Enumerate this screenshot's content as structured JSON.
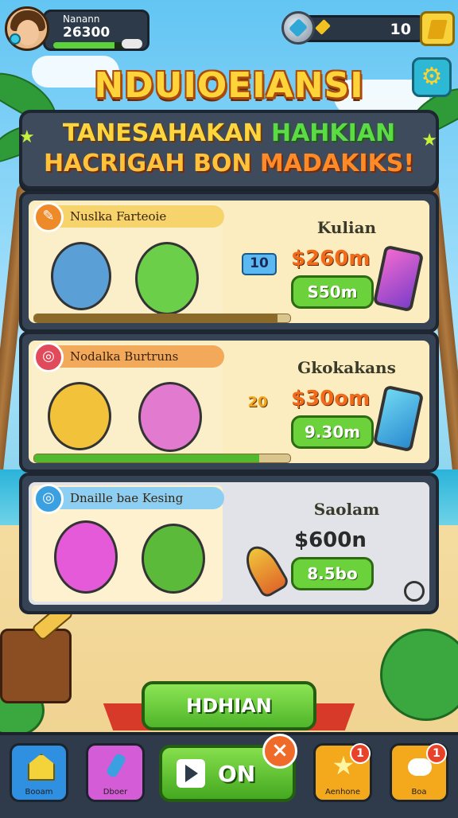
{
  "player": {
    "name": "Nanann",
    "score": "26300",
    "xp_progress": 0.85
  },
  "currency": {
    "gems_value": "10"
  },
  "title": "NDUIOEIANSI",
  "banner": {
    "line1_a": "TANESAHAKAN",
    "line1_b": "HAHKIAN",
    "line2_a": "HACRIGAH BON",
    "line2_b": "MADAKIKS!"
  },
  "offers": [
    {
      "tag": "Nuslka Farteoie",
      "right_title": "Kulian",
      "badge_value": "10",
      "price": "$260m",
      "buy_label": "S50m",
      "tag_color": "#f29a2e",
      "progress": 0.95
    },
    {
      "tag": "Nodalka Burtruns",
      "right_title": "Gkokakans",
      "badge_value": "20",
      "price": "$30om",
      "buy_label": "9.30m",
      "tag_color": "#ef7a32",
      "progress": 0.88
    },
    {
      "tag": "Dnaille bae Kesing",
      "right_title": "Saolam",
      "badge_value": "",
      "price": "$600n",
      "buy_label": "8.5bo",
      "tag_color": "#56b9ea",
      "progress": 0
    }
  ],
  "main_button": "HDHIAN",
  "nav": [
    {
      "label": "Booam",
      "color": "#2f8fe0",
      "notification": ""
    },
    {
      "label": "Dboer",
      "color": "#d45cd6",
      "notification": ""
    },
    {
      "label": "ON",
      "color": "#4fb52a",
      "notification": "×"
    },
    {
      "label": "Aenhone",
      "color": "#f4a81c",
      "notification": "1"
    },
    {
      "label": "Boa",
      "color": "#f4a81c",
      "notification": "1"
    }
  ],
  "colors": {
    "accent_green": "#6cd23c",
    "title_gold": "#ffd43b",
    "panel": "#364354"
  }
}
